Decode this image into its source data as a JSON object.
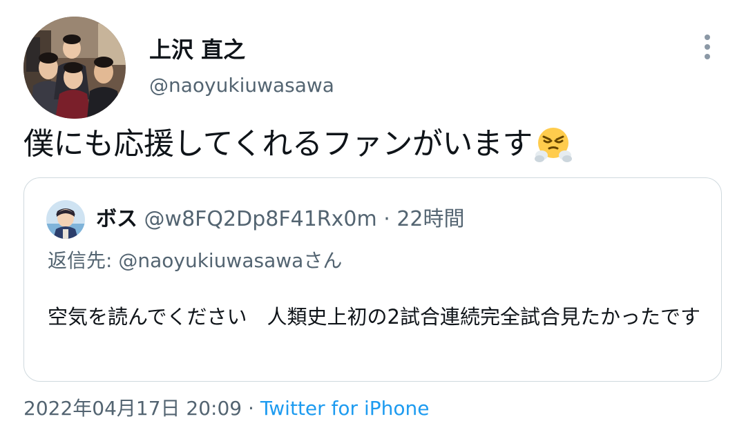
{
  "author": {
    "display_name": "上沢 直之",
    "handle": "@naoyukiuwasawa"
  },
  "tweet": {
    "text": "僕にも応援してくれるファンがいます",
    "emoji": "face-with-steam-from-nose-icon"
  },
  "quote": {
    "name": "ボス",
    "handle": "@w8FQ2Dp8F41Rx0m",
    "separator": "·",
    "time_ago": "22時間",
    "reply_label": "返信先: ",
    "reply_handle": "@naoyukiuwasawa",
    "reply_suffix": "さん",
    "text": "空気を読んでください　人類史上初の2試合連続完全試合見たかったです"
  },
  "meta": {
    "timestamp": "2022年04月17日 20:09",
    "separator": " · ",
    "source": "Twitter for iPhone"
  },
  "colors": {
    "accent": "#1d9bf0",
    "secondary_text": "#536471",
    "border": "#cfd9de"
  }
}
